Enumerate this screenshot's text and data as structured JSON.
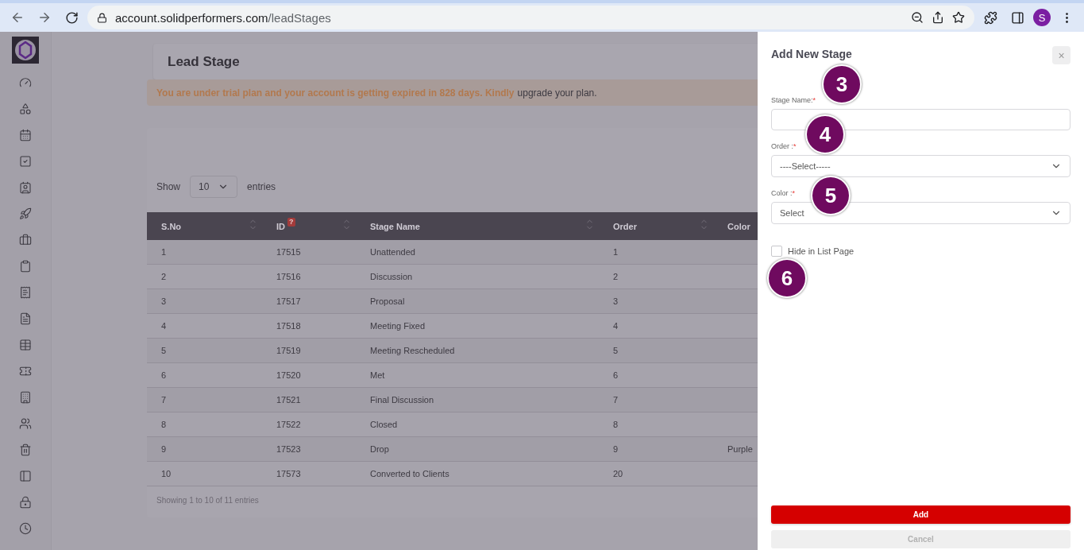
{
  "browser": {
    "url_host": "account.solidperformers.com",
    "url_path": "/leadStages",
    "profile_initial": "S"
  },
  "page": {
    "title": "Lead Stage",
    "trial_banner": {
      "text": "You are under trial plan and your account is getting expired in 828 days. Kindly",
      "link": "upgrade your plan",
      "suffix": "."
    },
    "table": {
      "show_label": "Show",
      "page_size": "10",
      "entries_label": "entries",
      "columns": [
        {
          "label": "S.No",
          "sortable": true
        },
        {
          "label": "ID",
          "sortable": true,
          "help": "?"
        },
        {
          "label": "Stage Name",
          "sortable": true
        },
        {
          "label": "Order",
          "sortable": true
        },
        {
          "label": "Color",
          "sortable": false
        }
      ],
      "rows": [
        [
          "1",
          "17515",
          "Unattended",
          "1",
          ""
        ],
        [
          "2",
          "17516",
          "Discussion",
          "2",
          ""
        ],
        [
          "3",
          "17517",
          "Proposal",
          "3",
          ""
        ],
        [
          "4",
          "17518",
          "Meeting Fixed",
          "4",
          ""
        ],
        [
          "5",
          "17519",
          "Meeting Rescheduled",
          "5",
          ""
        ],
        [
          "6",
          "17520",
          "Met",
          "6",
          ""
        ],
        [
          "7",
          "17521",
          "Final Discussion",
          "7",
          ""
        ],
        [
          "8",
          "17522",
          "Closed",
          "8",
          ""
        ],
        [
          "9",
          "17523",
          "Drop",
          "9",
          "Purple"
        ],
        [
          "10",
          "17573",
          "Converted to Clients",
          "20",
          ""
        ]
      ],
      "info": "Showing 1 to 10 of 11 entries"
    }
  },
  "drawer": {
    "title": "Add New Stage",
    "close": "×",
    "fields": [
      {
        "kind": "text",
        "label": "Stage Name:",
        "required_mark": "*"
      },
      {
        "kind": "select",
        "label": "Order :",
        "required_mark": "*",
        "value": "----Select-----"
      },
      {
        "kind": "select",
        "label": "Color :",
        "required_mark": "*",
        "value": "Select"
      }
    ],
    "checkbox": {
      "label": "Hide in List Page",
      "checked": false
    },
    "buttons": [
      {
        "label": "Add",
        "kind": "primary"
      },
      {
        "label": "Cancel",
        "kind": "secondary"
      }
    ]
  },
  "callouts": [
    "3",
    "4",
    "5",
    "6"
  ]
}
